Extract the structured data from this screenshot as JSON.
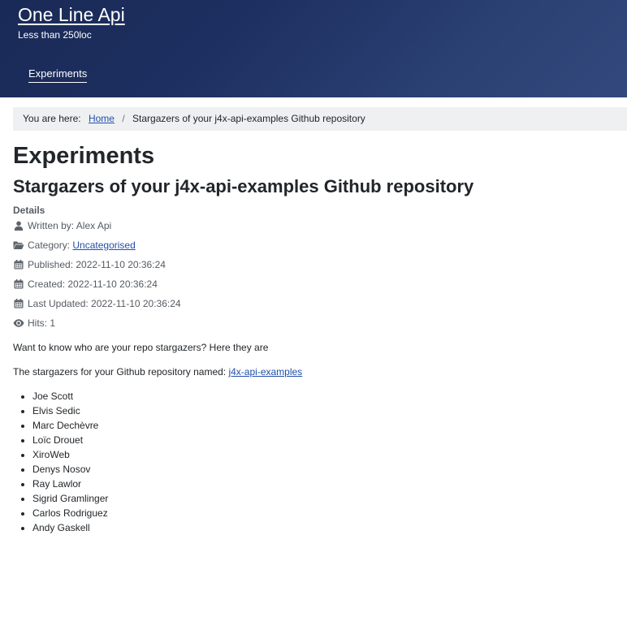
{
  "site": {
    "name": "One Line Api",
    "tagline": "Less than 250loc",
    "nav": [
      {
        "label": "Experiments"
      }
    ]
  },
  "breadcrumb": {
    "prefix": "You are here:",
    "home": "Home",
    "separator": "/",
    "current": "Stargazers of your j4x-api-examples Github repository"
  },
  "page": {
    "heading": "Experiments",
    "title": "Stargazers of your j4x-api-examples Github repository"
  },
  "details": {
    "label": "Details",
    "author": "Written by: Alex Api",
    "category_prefix": "Category:",
    "category": "Uncategorised",
    "published": "Published: 2022-11-10 20:36:24",
    "created": "Created: 2022-11-10 20:36:24",
    "updated": "Last Updated: 2022-11-10 20:36:24",
    "hits": "Hits: 1",
    "icons": [
      "user-icon",
      "folder-open-icon",
      "calendar-icon",
      "calendar-icon",
      "calendar-icon",
      "eye-icon"
    ]
  },
  "content": {
    "intro": "Want to know who are your repo stargazers? Here they are",
    "repo_prefix": "The stargazers for your Github repository named:",
    "repo_link": "j4x-api-examples",
    "stargazers": [
      "Joe Scott",
      "Elvis Sedic",
      "Marc Dechèvre",
      "Loïc Drouet",
      "XiroWeb",
      "Denys Nosov",
      "Ray Lawlor",
      "Sigrid Gramlinger",
      "Carlos Rodriguez",
      "Andy Gaskell"
    ]
  },
  "colors": {
    "header_dark": "#1a2a57",
    "header_light": "#33497d",
    "link": "#224faa",
    "breadcrumb_bg": "#eef0f2"
  }
}
